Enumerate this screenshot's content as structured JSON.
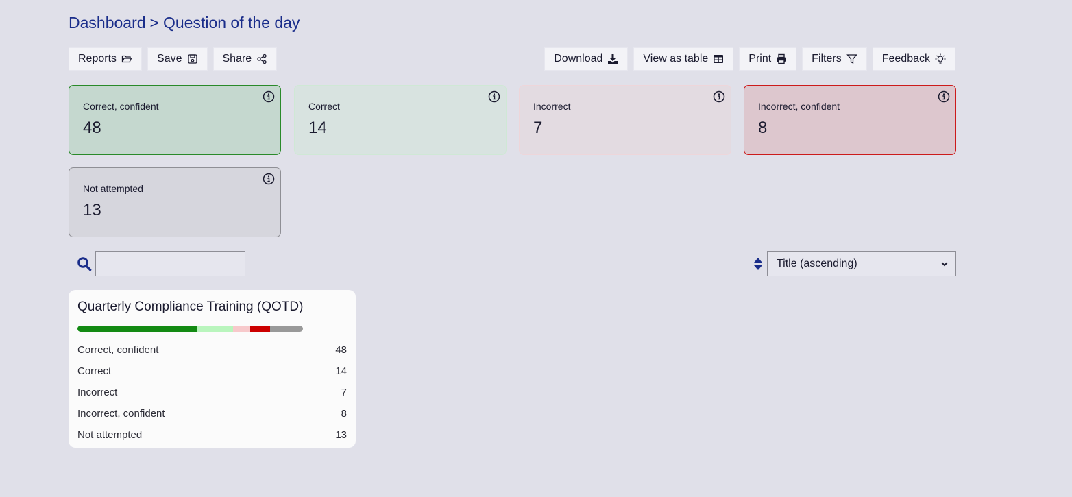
{
  "breadcrumb": {
    "root": "Dashboard",
    "separator": ">",
    "current": "Question of the day"
  },
  "toolbar_left": [
    {
      "label": "Reports",
      "icon": "folder-open-icon"
    },
    {
      "label": "Save",
      "icon": "floppy-disk-icon"
    },
    {
      "label": "Share",
      "icon": "share-nodes-icon"
    }
  ],
  "toolbar_right": [
    {
      "label": "Download",
      "icon": "download-icon"
    },
    {
      "label": "View as table",
      "icon": "table-icon"
    },
    {
      "label": "Print",
      "icon": "printer-icon"
    },
    {
      "label": "Filters",
      "icon": "funnel-icon"
    },
    {
      "label": "Feedback",
      "icon": "lightbulb-icon"
    }
  ],
  "cards": [
    {
      "label": "Correct, confident",
      "value": "48"
    },
    {
      "label": "Correct",
      "value": "14"
    },
    {
      "label": "Incorrect",
      "value": "7"
    },
    {
      "label": "Incorrect, confident",
      "value": "8"
    },
    {
      "label": "Not attempted",
      "value": "13"
    }
  ],
  "search": {
    "value": ""
  },
  "sort": {
    "selected": "Title (ascending)"
  },
  "panel": {
    "title": "Quarterly Compliance Training (QOTD)",
    "rows": [
      {
        "label": "Correct, confident",
        "value": 48,
        "color": "#138a13"
      },
      {
        "label": "Correct",
        "value": 14,
        "color": "#b9f5bd"
      },
      {
        "label": "Incorrect",
        "value": 7,
        "color": "#f7c9cb"
      },
      {
        "label": "Incorrect, confident",
        "value": 8,
        "color": "#cc0000"
      },
      {
        "label": "Not attempted",
        "value": 13,
        "color": "#999999"
      }
    ]
  },
  "colors": {
    "background": "#e0e0e9",
    "breadcrumb": "#1a2d8a",
    "icon_accent": "#1a2d8a"
  }
}
